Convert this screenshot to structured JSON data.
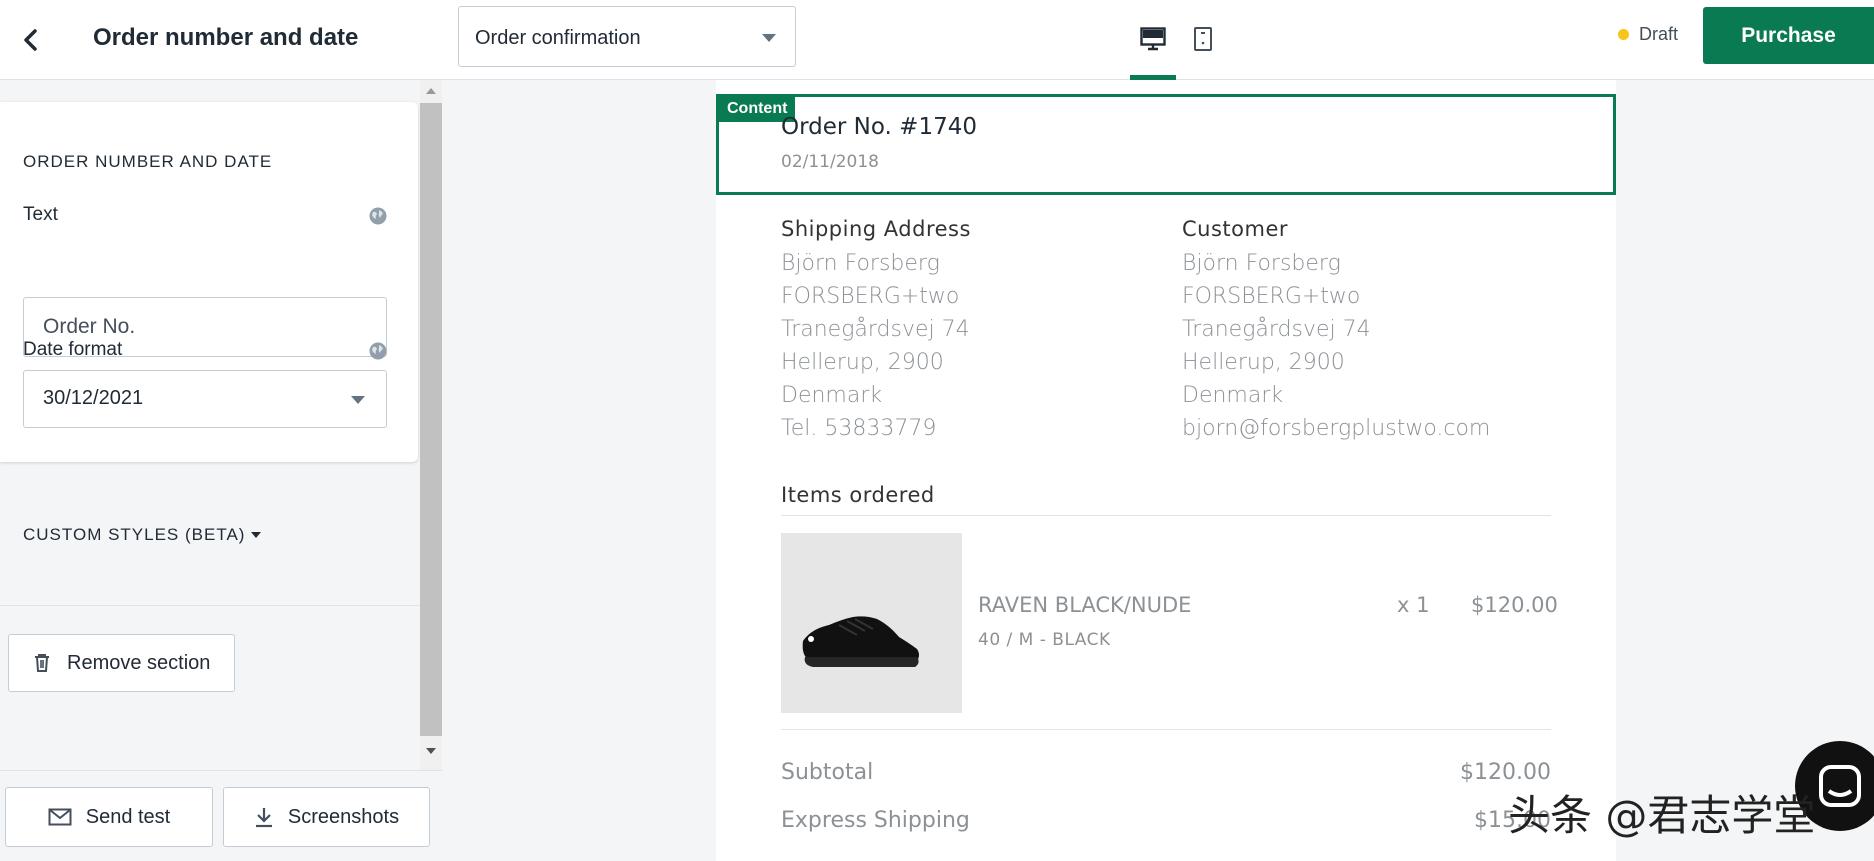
{
  "sidebar": {
    "title": "Order number and date",
    "section_heading": "ORDER NUMBER AND DATE",
    "text_label": "Text",
    "text_value": "Order No.",
    "date_label": "Date format",
    "date_value": "30/12/2021",
    "custom_styles": "CUSTOM STYLES (BETA)",
    "remove_section": "Remove section",
    "send_test": "Send test",
    "screenshots": "Screenshots"
  },
  "topbar": {
    "template": "Order confirmation",
    "status": "Draft",
    "status_color": "#f5c518",
    "purchase": "Purchase",
    "accent_color": "#0a7a53",
    "views": [
      "desktop-icon",
      "mobile-icon"
    ],
    "active_view": "desktop"
  },
  "preview": {
    "content_tag": "Content",
    "order_no": "Order No. #1740",
    "order_date": "02/11/2018",
    "shipping": {
      "heading": "Shipping Address",
      "lines": [
        "Björn Forsberg",
        "FORSBERG+two",
        "Tranegårdsvej 74",
        "Hellerup, 2900",
        "Denmark",
        "Tel. 53833779"
      ]
    },
    "customer": {
      "heading": "Customer",
      "lines": [
        "Björn Forsberg",
        "FORSBERG+two",
        "Tranegårdsvej 74",
        "Hellerup, 2900",
        "Denmark",
        "bjorn@forsbergplustwo.com"
      ]
    },
    "items_heading": "Items ordered",
    "item": {
      "name": "RAVEN BLACK/NUDE",
      "variant": "40 / M - BLACK",
      "qty": "x 1",
      "price": "$120.00"
    },
    "totals": [
      {
        "label": "Subtotal",
        "value": "$120.00"
      },
      {
        "label": "Express Shipping",
        "value": "$15.00"
      }
    ]
  },
  "watermark": "头条 @君志学堂"
}
